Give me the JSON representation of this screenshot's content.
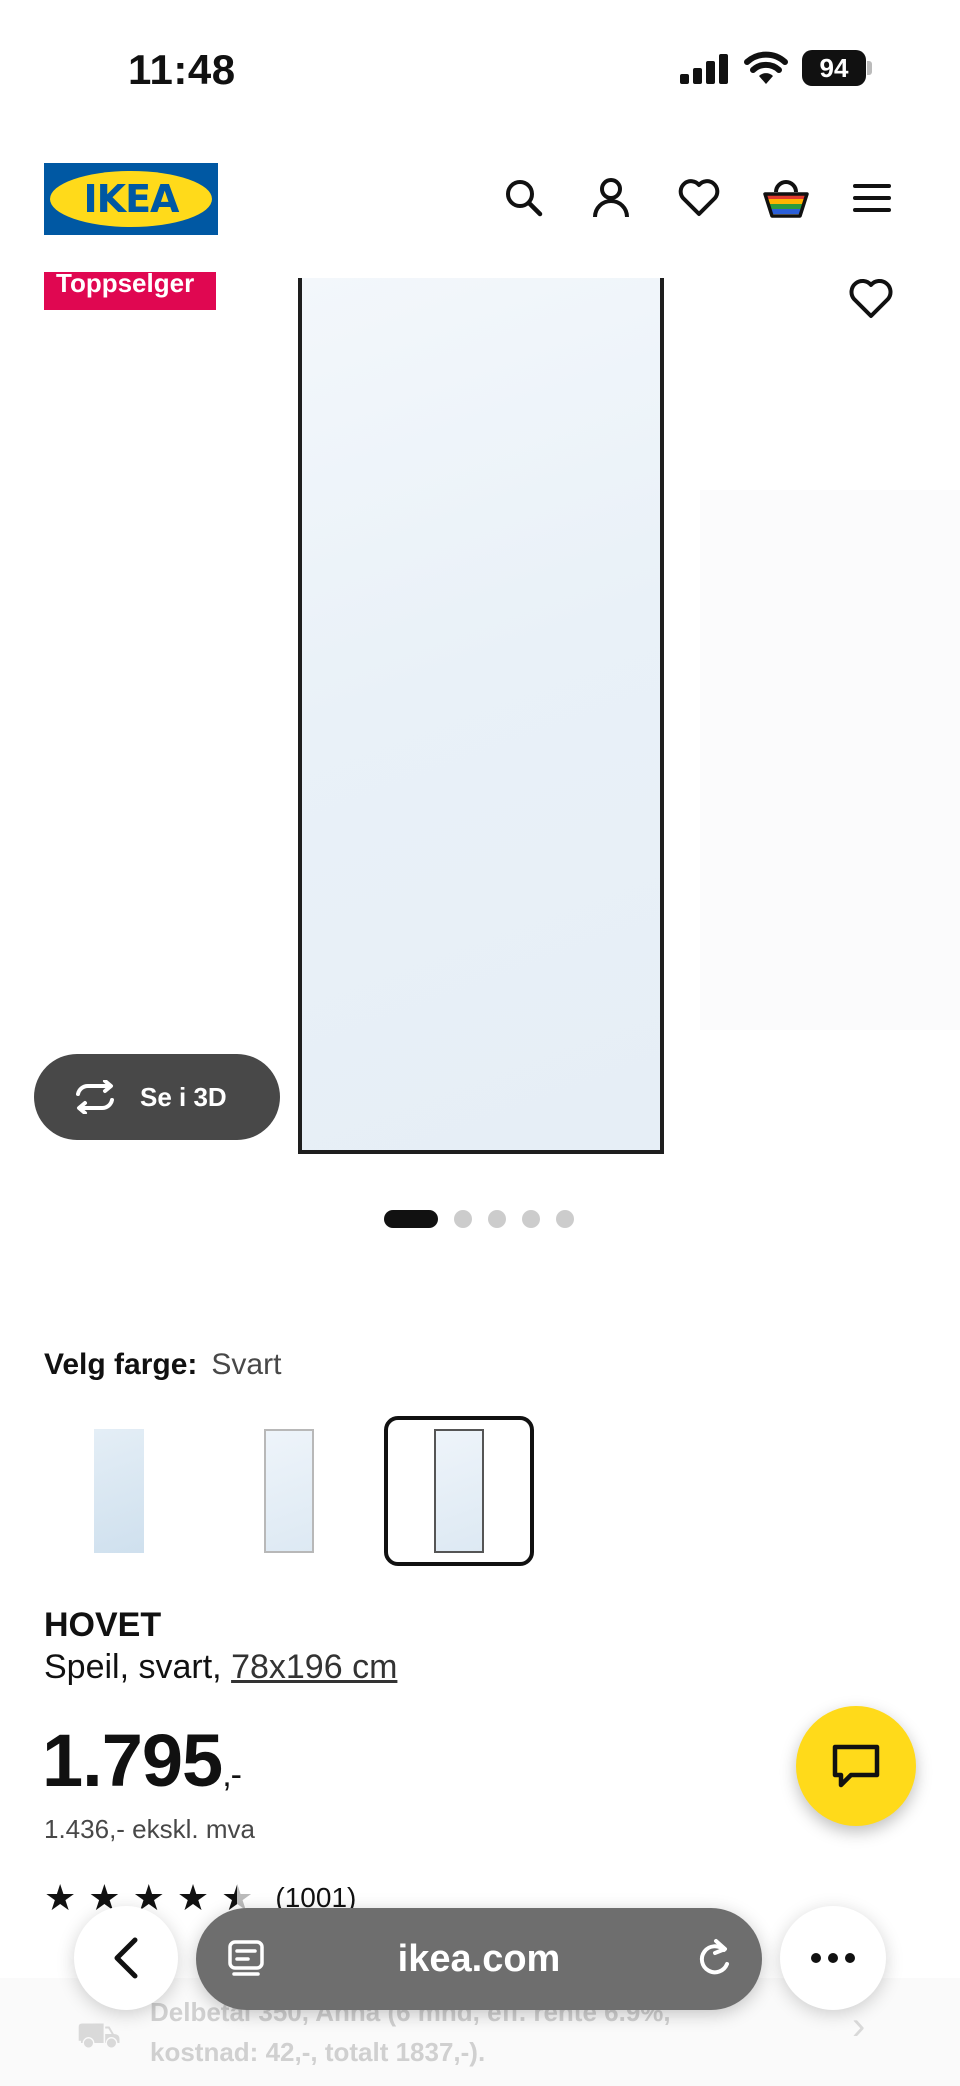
{
  "status_bar": {
    "time": "11:48",
    "battery": "94"
  },
  "header": {
    "logo_text": "IKEA",
    "icons": [
      "search-icon",
      "account-icon",
      "heart-icon",
      "cart-icon",
      "menu-icon"
    ]
  },
  "gallery": {
    "badge": "Toppselger",
    "view_3d_label": "Se i 3D",
    "image_count": 5,
    "active_image": 1
  },
  "color": {
    "label": "Velg farge:",
    "selected": "Svart",
    "options_count": 3
  },
  "product": {
    "name": "HOVET",
    "description": "Speil, svart, ",
    "size_link": "78x196 cm",
    "price": "1.795",
    "price_suffix": ",-",
    "price_ex_vat": "1.436,- ekskl. mva",
    "rating": 4.5,
    "review_count": "(1001)"
  },
  "financing": {
    "text": "Delbetal 350, Anna (6 mnd, eff. rente 6.9%, kostnad: 42,-, totalt 1837,-)."
  },
  "browser": {
    "url": "ikea.com"
  },
  "colors": {
    "ikea_blue": "#0058a3",
    "ikea_yellow": "#ffda1a",
    "badge_red": "#e00751"
  }
}
